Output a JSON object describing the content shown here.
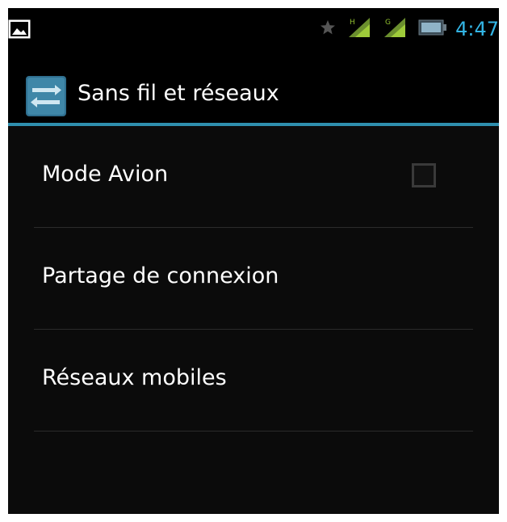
{
  "status_bar": {
    "time": "4:47",
    "icons": [
      "gallery-icon",
      "star-icon",
      "signal-h-icon",
      "signal-g-icon",
      "battery-icon"
    ],
    "time_color": "#33b5e5"
  },
  "action_bar": {
    "title": "Sans fil et réseaux",
    "icon": "settings-icon"
  },
  "list": {
    "items": [
      {
        "label": "Mode Avion",
        "has_checkbox": true,
        "checked": false
      },
      {
        "label": "Partage de connexion"
      },
      {
        "label": "Réseaux mobiles"
      }
    ]
  },
  "colors": {
    "background": "#0b0b0b",
    "accent": "#33b5e5",
    "divider": "#2f8fae",
    "text": "#ffffff"
  }
}
